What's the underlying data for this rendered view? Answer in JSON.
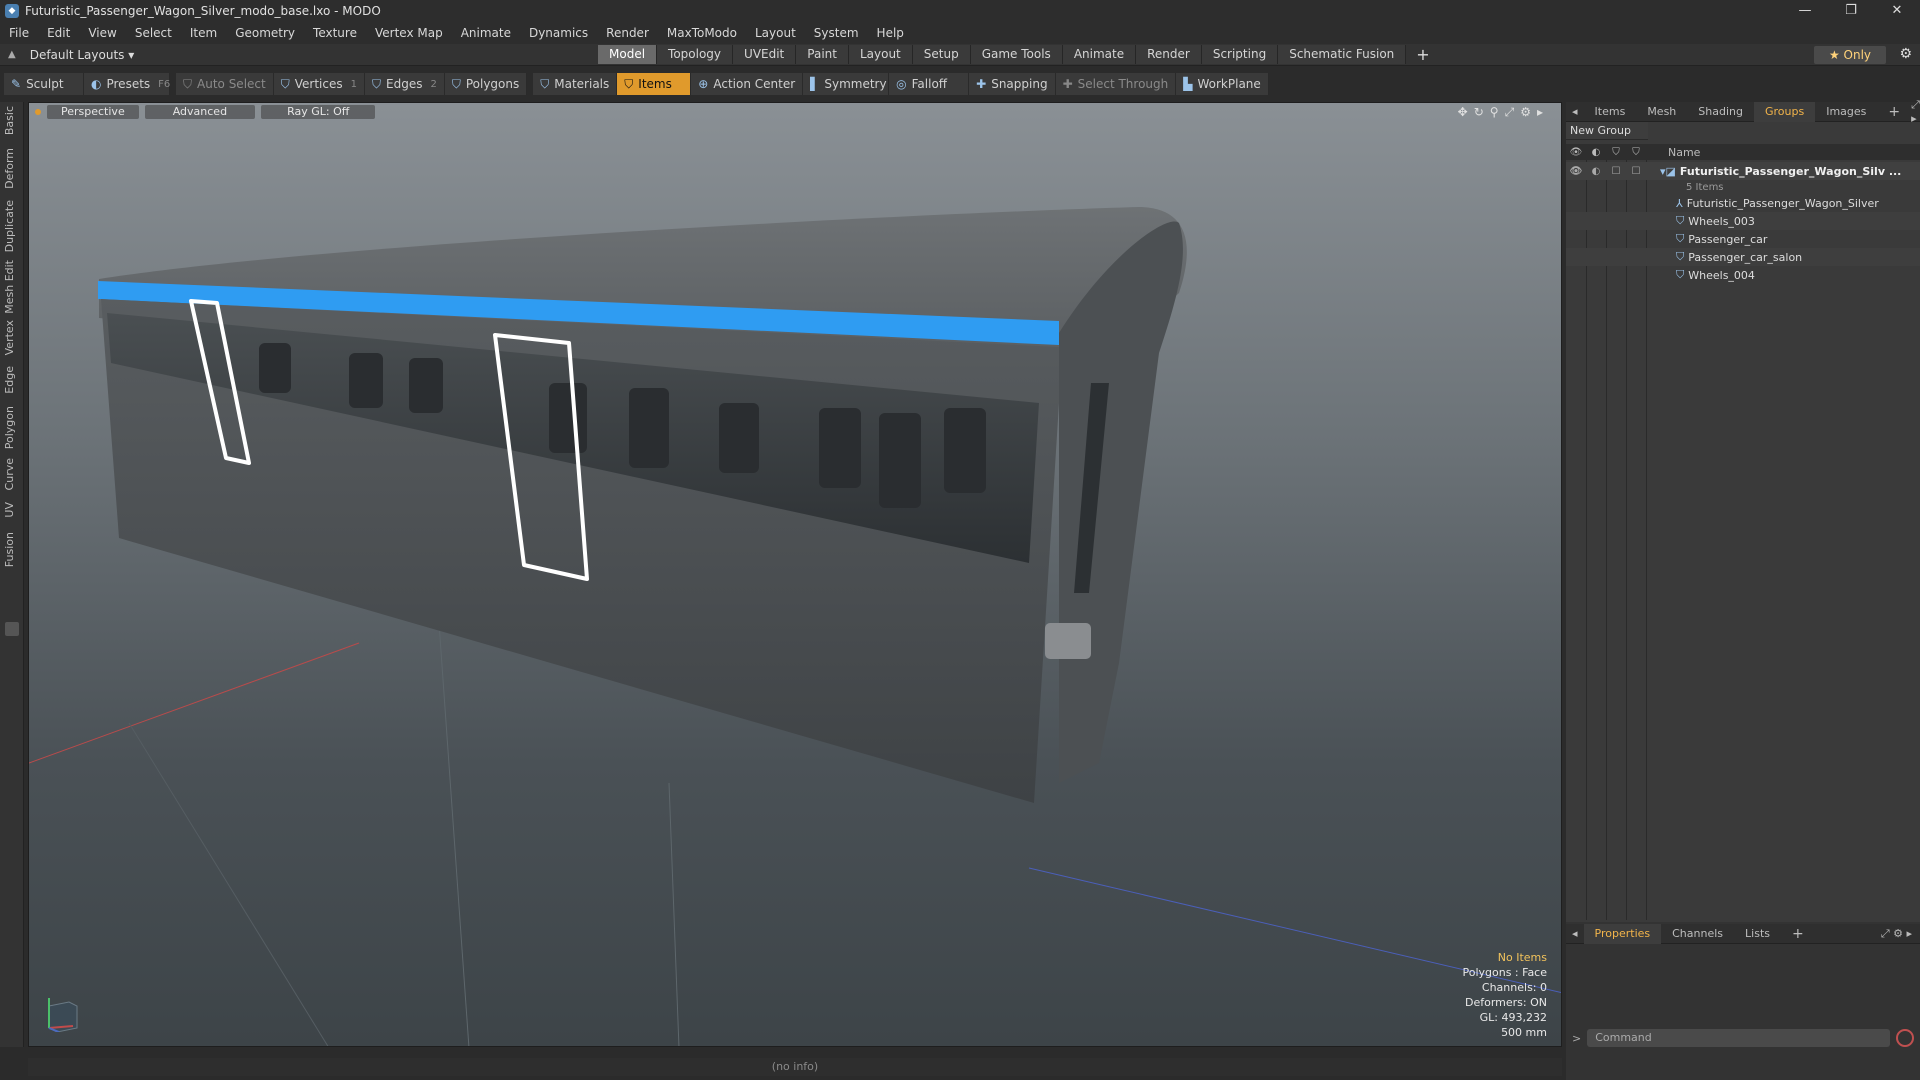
{
  "window": {
    "title": "Futuristic_Passenger_Wagon_Silver_modo_base.lxo - MODO",
    "controls": [
      "—",
      "❐",
      "✕"
    ]
  },
  "menu": [
    "File",
    "Edit",
    "View",
    "Select",
    "Item",
    "Geometry",
    "Texture",
    "Vertex Map",
    "Animate",
    "Dynamics",
    "Render",
    "MaxToModo",
    "Layout",
    "System",
    "Help"
  ],
  "layout_selector": "Default Layouts ▾",
  "tabs": [
    {
      "label": "Model",
      "active": true
    },
    {
      "label": "Topology"
    },
    {
      "label": "UVEdit"
    },
    {
      "label": "Paint"
    },
    {
      "label": "Layout"
    },
    {
      "label": "Setup"
    },
    {
      "label": "Game Tools"
    },
    {
      "label": "Animate"
    },
    {
      "label": "Render"
    },
    {
      "label": "Scripting"
    },
    {
      "label": "Schematic Fusion"
    }
  ],
  "only_label": "★  Only",
  "toolbar": {
    "sculpt": "Sculpt",
    "presets": "Presets",
    "presets_key": "F6",
    "auto_select": "Auto Select",
    "vertices": "Vertices",
    "vertices_count": "1",
    "edges": "Edges",
    "edges_count": "2",
    "polygons": "Polygons",
    "materials": "Materials",
    "items": "Items",
    "action_center": "Action Center",
    "symmetry": "Symmetry",
    "falloff": "Falloff",
    "snapping": "Snapping",
    "select_through": "Select Through",
    "workplane": "WorkPlane"
  },
  "left_tabs": [
    "Basic",
    "Deform",
    "Duplicate",
    "Mesh Edit",
    "Vertex",
    "Edge",
    "Polygon",
    "Curve",
    "UV",
    "Fusion"
  ],
  "viewport": {
    "perspective": "Perspective",
    "advanced": "Advanced",
    "raygl": "Ray GL: Off",
    "info": {
      "no_items": "No Items",
      "polygons": "Polygons : Face",
      "channels": "Channels: 0",
      "deformers": "Deformers: ON",
      "gl": "GL: 493,232",
      "scale": "500 mm"
    }
  },
  "status": "(no info)",
  "right_panel": {
    "tabs": [
      "Items",
      "Mesh ...",
      "Shading",
      "Groups",
      "Images"
    ],
    "active_tab": "Groups",
    "new_group": "New Group",
    "name_col": "Name",
    "group_name": "Futuristic_Passenger_Wagon_Silv ...",
    "group_count": "5 Items",
    "items": [
      "Futuristic_Passenger_Wagon_Silver",
      "Wheels_003",
      "Passenger_car",
      "Passenger_car_salon",
      "Wheels_004"
    ]
  },
  "bottom_panel": {
    "tabs": [
      "Properties",
      "Channels",
      "Lists"
    ],
    "active_tab": "Properties",
    "command_placeholder": "Command"
  },
  "colors": {
    "accent": "#e09a2c",
    "stripe": "#2f9cf2",
    "selection": "#ffffff"
  }
}
